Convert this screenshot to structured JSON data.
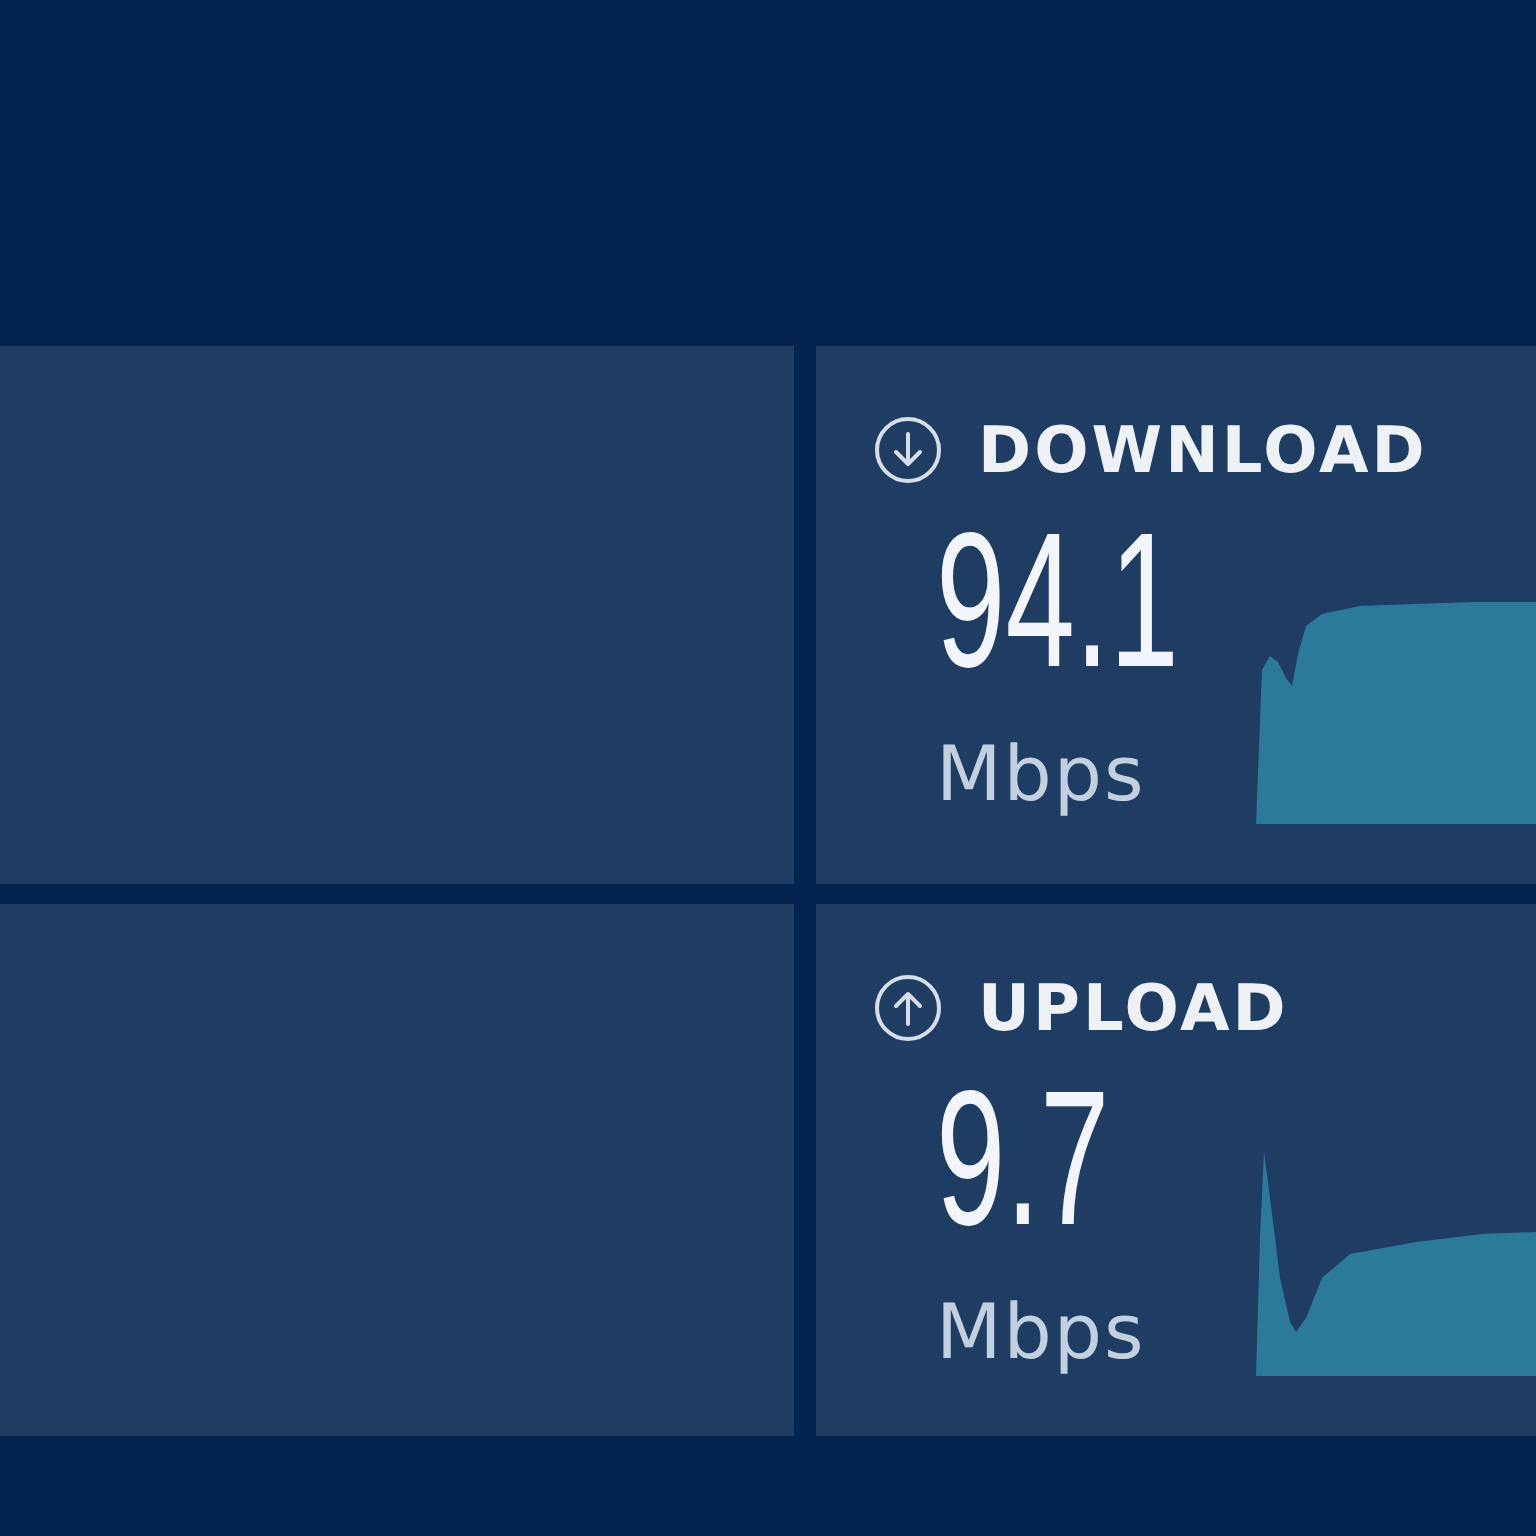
{
  "results": [
    {
      "kind": "download",
      "label": "DOWNLOAD",
      "value": "94.1",
      "unit": "Mbps"
    },
    {
      "kind": "upload",
      "label": "UPLOAD",
      "value": "9.7",
      "unit": "Mbps"
    }
  ]
}
